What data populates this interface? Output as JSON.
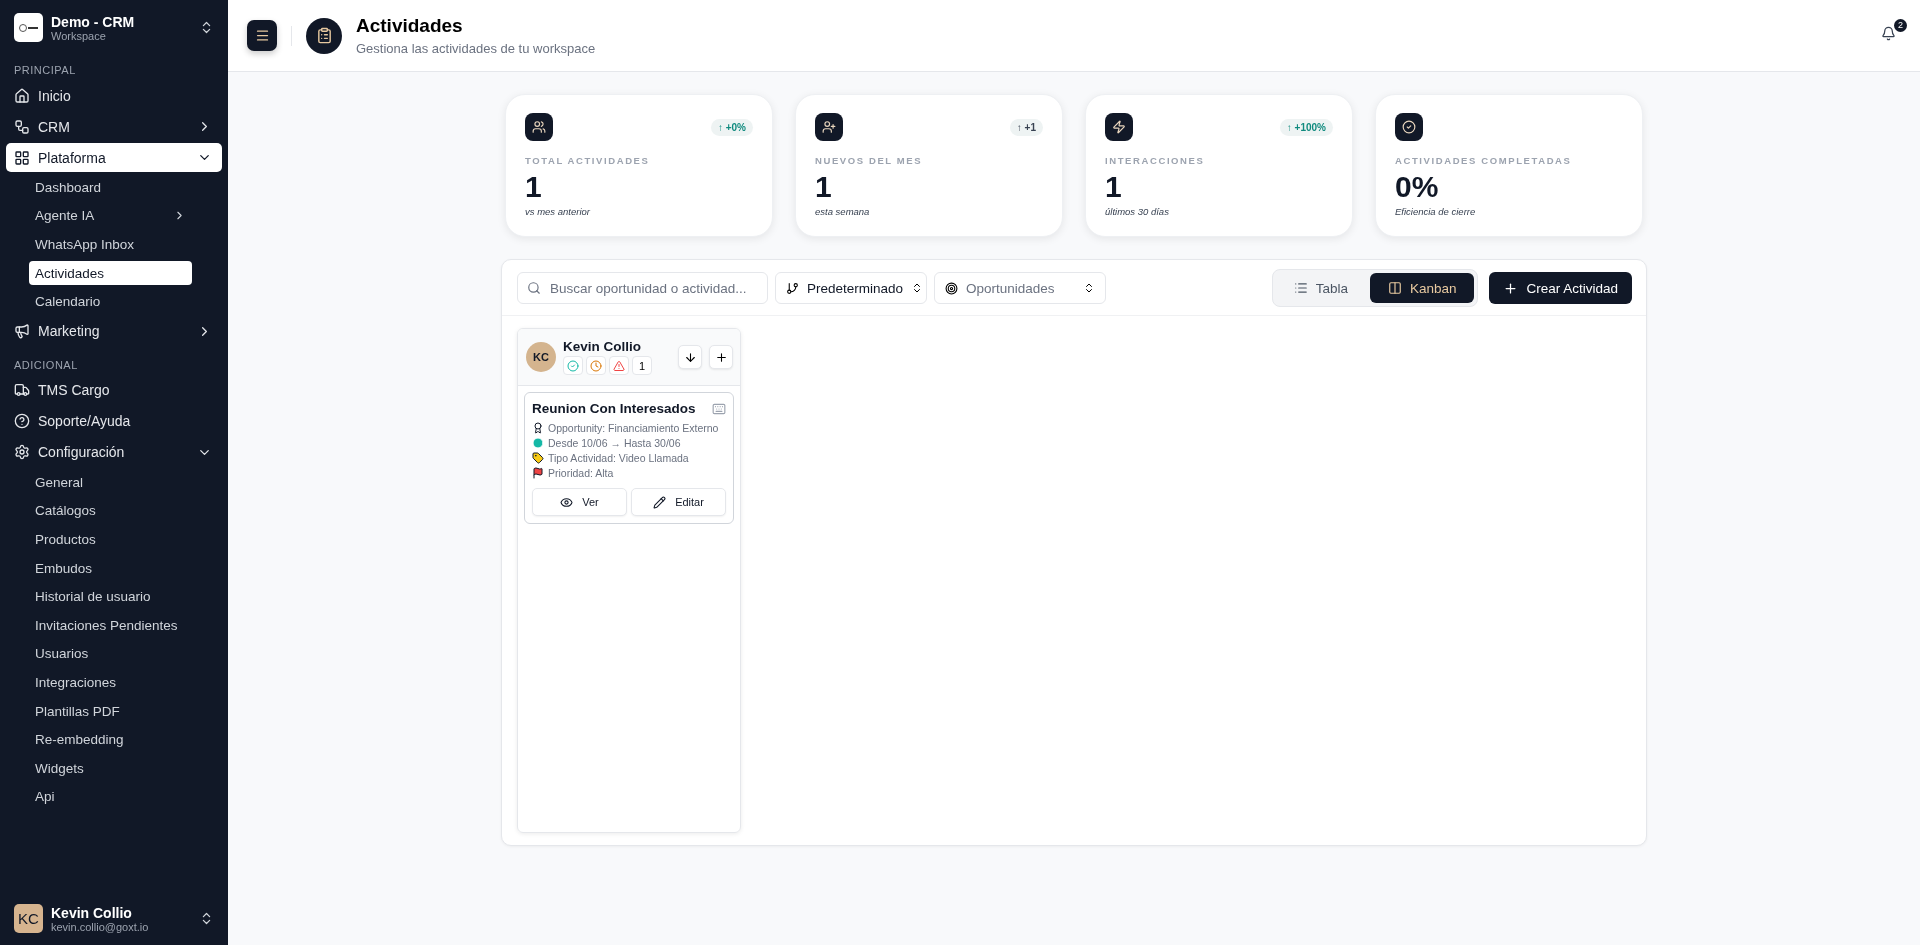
{
  "sidebar": {
    "workspace": {
      "name": "Demo - CRM",
      "subtitle": "Workspace"
    },
    "sections": [
      {
        "title": "PRINCIPAL",
        "items": [
          {
            "label": "Inicio",
            "kind": "link",
            "selected": false
          },
          {
            "label": "CRM",
            "kind": "group",
            "expanded": false,
            "selected": false
          },
          {
            "label": "Plataforma",
            "kind": "group",
            "expanded": true,
            "selected": true,
            "children": [
              {
                "label": "Dashboard",
                "selected": false
              },
              {
                "label": "Agente IA",
                "selected": false,
                "expanded": false
              },
              {
                "label": "WhatsApp Inbox",
                "selected": false
              },
              {
                "label": "Actividades",
                "selected": true
              },
              {
                "label": "Calendario",
                "selected": false
              }
            ]
          },
          {
            "label": "Marketing",
            "kind": "group",
            "expanded": false,
            "selected": false
          }
        ]
      },
      {
        "title": "ADICIONAL",
        "items": [
          {
            "label": "TMS Cargo",
            "kind": "link",
            "selected": false
          },
          {
            "label": "Soporte/Ayuda",
            "kind": "link",
            "selected": false
          },
          {
            "label": "Configuración",
            "kind": "group",
            "expanded": true,
            "selected": false,
            "children": [
              {
                "label": "General",
                "selected": false
              },
              {
                "label": "Catálogos",
                "selected": false
              },
              {
                "label": "Productos",
                "selected": false
              },
              {
                "label": "Embudos",
                "selected": false
              },
              {
                "label": "Historial de usuario",
                "selected": false
              },
              {
                "label": "Invitaciones Pendientes",
                "selected": false
              },
              {
                "label": "Usuarios",
                "selected": false
              },
              {
                "label": "Integraciones",
                "selected": false
              },
              {
                "label": "Plantillas PDF",
                "selected": false
              },
              {
                "label": "Re-embedding",
                "selected": false
              },
              {
                "label": "Widgets",
                "selected": false
              },
              {
                "label": "Api",
                "selected": false
              }
            ]
          }
        ]
      }
    ],
    "user": {
      "initials": "KC",
      "name": "Kevin Collio",
      "email": "kevin.collio@goxt.io"
    }
  },
  "header": {
    "title": "Actividades",
    "subtitle": "Gestiona las actividades de tu workspace",
    "notifications": "2"
  },
  "stats": [
    {
      "label": "TOTAL ACTIVIDADES",
      "value": "1",
      "note": "vs mes anterior",
      "badge": {
        "text": "↑ +0%",
        "color": "#0f8a7e"
      }
    },
    {
      "label": "NUEVOS DEL MES",
      "value": "1",
      "note": "esta semana",
      "badge": {
        "text": "↑ +1",
        "color": "#374151"
      }
    },
    {
      "label": "INTERACCIONES",
      "value": "1",
      "note": "últimos 30 días",
      "badge": {
        "text": "↑ +100%",
        "color": "#0f8a7e"
      }
    },
    {
      "label": "ACTIVIDADES COMPLETADAS",
      "value": "0%",
      "note": "Eficiencia de cierre"
    }
  ],
  "toolbar": {
    "search": {
      "placeholder": "Buscar oportunidad o actividad..."
    },
    "selects": [
      {
        "value": "Predeterminado"
      },
      {
        "placeholder": "Oportunidades"
      }
    ],
    "views": [
      {
        "label": "Tabla",
        "selected": false
      },
      {
        "label": "Kanban",
        "selected": true
      }
    ],
    "create_button": "Crear Actividad"
  },
  "columns": [
    {
      "owner": {
        "initials": "KC",
        "name": "Kevin Collio"
      },
      "count": "1",
      "cards": [
        {
          "title": "Reunion Con Interesados",
          "lines": [
            "Opportunity: Financiamiento Externo",
            "Desde 10/06 → Hasta 30/06",
            "Tipo Actividad: Video Llamada",
            "Prioridad: Alta"
          ],
          "buttons": [
            "Ver",
            "Editar"
          ]
        }
      ]
    }
  ]
}
